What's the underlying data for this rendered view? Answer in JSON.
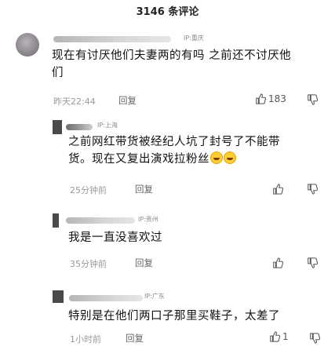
{
  "header": {
    "title": "3146 条评论"
  },
  "comments": [
    {
      "ip": "IP:重庆",
      "text_line1": "现在有讨厌他们夫妻两的有吗  之前还不讨厌他",
      "text_line2": "们",
      "time": "昨天22:44",
      "reply": "回复",
      "likes": "183"
    },
    {
      "ip": "IP:上海",
      "text_line1": "之前网红带货被经纪人坑了封号了不能带",
      "text_line2": "货。现在又复出演戏拉粉丝",
      "time": "25分钟前",
      "reply": "回复",
      "likes": ""
    },
    {
      "ip": "IP:贵州",
      "text_line1": "我是一直没喜欢过",
      "time": "35分钟前",
      "reply": "回复",
      "likes": ""
    },
    {
      "ip": "IP:广东",
      "text_line1": "特别是在他们两口子那里买鞋子，太差了",
      "time": "1小时前",
      "reply": "回复",
      "likes": "1"
    }
  ],
  "icons": {
    "like": "thumb-up-icon",
    "dislike": "thumb-down-icon",
    "emoji": "laughing-tears-emoji"
  },
  "colors": {
    "text": "#111111",
    "meta": "#9a9a9a",
    "ip": "#8a8a8a"
  }
}
